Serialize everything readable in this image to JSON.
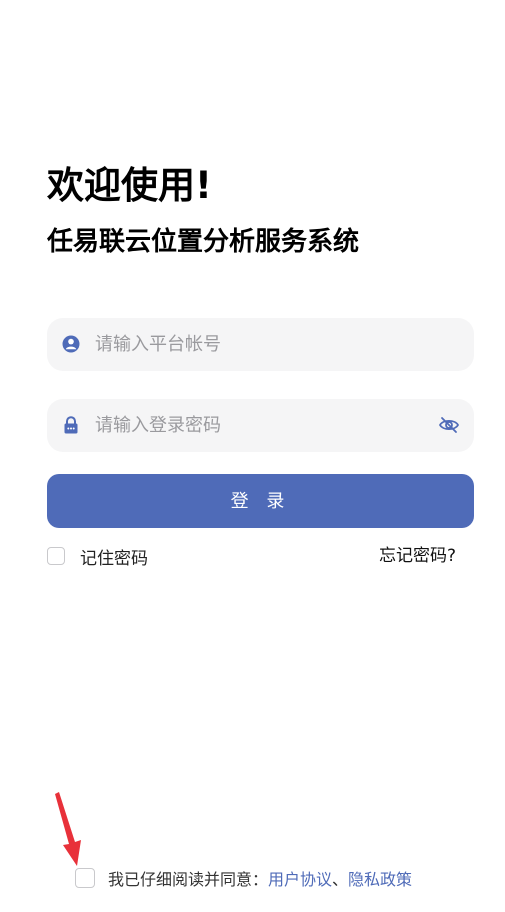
{
  "header": {
    "welcome": "欢迎使用!",
    "system_name": "任易联云位置分析服务系统"
  },
  "form": {
    "account_placeholder": "请输入平台帐号",
    "password_placeholder": "请输入登录密码",
    "login_label": "登 录",
    "remember_label": "记住密码",
    "forgot_label": "忘记密码?"
  },
  "agreement": {
    "prefix": "我已仔细阅读并同意：",
    "user_agreement": "用户协议",
    "separator": "、",
    "privacy_policy": "隐私政策"
  },
  "icons": {
    "account": "user-icon",
    "password": "lock-icon",
    "visibility": "eye-off-icon",
    "annotation": "red-arrow"
  },
  "colors": {
    "accent": "#4f6bb8",
    "field_bg": "#f5f5f6",
    "annotation_arrow": "#e8313a"
  }
}
